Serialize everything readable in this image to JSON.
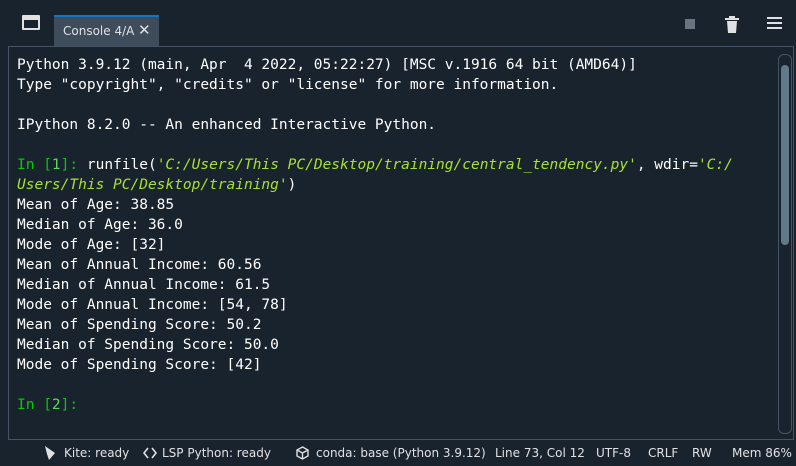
{
  "tab": {
    "label": "Console 4/A",
    "close_glyph": "✕"
  },
  "toolbar": {
    "icons": [
      "window-pane-icon",
      "stop-icon",
      "trash-icon",
      "menu-icon"
    ]
  },
  "console": {
    "banner1": "Python 3.9.12 (main, Apr  4 2022, 05:22:27) [MSC v.1916 64 bit (AMD64)]",
    "banner2": "Type \"copyright\", \"credits\" or \"license\" for more information.",
    "banner3": "IPython 8.2.0 -- An enhanced Interactive Python.",
    "in1_label": "In [",
    "in1_num": "1",
    "in1_close": "]:",
    "cmd_func": " runfile(",
    "cmd_path": "'C:/Users/This PC/Desktop/training/central_tendency.py'",
    "cmd_sep": ", wdir=",
    "cmd_wdir_a": "'C:/",
    "cmd_wdir_b": "Users/This PC/Desktop/training'",
    "cmd_end": ")",
    "outputs": [
      "Mean of Age: 38.85",
      "Median of Age: 36.0",
      "Mode of Age: [32]",
      "Mean of Annual Income: 60.56",
      "Median of Annual Income: 61.5",
      "Mode of Annual Income: [54, 78]",
      "Mean of Spending Score: 50.2",
      "Median of Spending Score: 50.0",
      "Mode of Spending Score: [42]"
    ],
    "in2_label": "In [",
    "in2_num": "2",
    "in2_close": "]:"
  },
  "statusbar": {
    "kite": "Kite: ready",
    "lsp": "LSP Python: ready",
    "conda": "conda: base (Python 3.9.12)",
    "position": "Line 73, Col 12",
    "encoding": "UTF-8",
    "eol": "CRLF",
    "mode": "RW",
    "memory": "Mem 86%"
  },
  "colors": {
    "background": "#19232d",
    "tab": "#3e4c5c",
    "prompt": "#00cc00",
    "string": "#a6e22e",
    "accent": "#1a72bb"
  }
}
